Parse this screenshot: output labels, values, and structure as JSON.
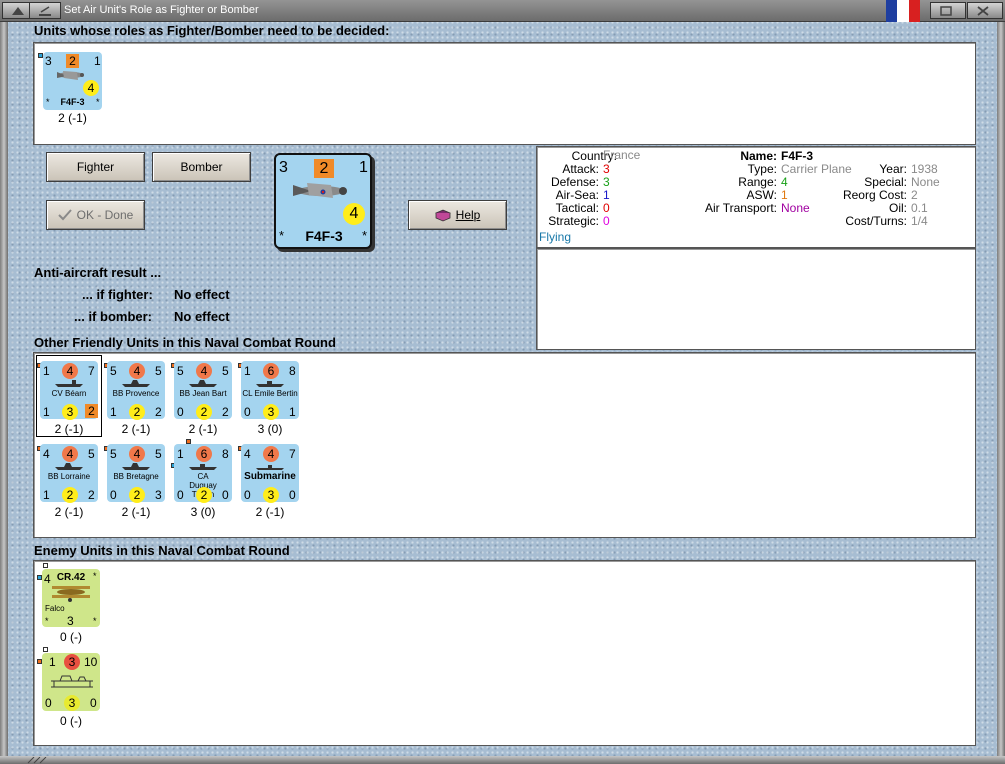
{
  "window": {
    "title": "Set Air Unit's Role as Fighter or Bomber"
  },
  "colors": {
    "flag": [
      "#1e3ea0",
      "#ffffff",
      "#d82020"
    ]
  },
  "sections": {
    "undecided": "Units whose roles as Fighter/Bomber need to be decided:",
    "friendly": "Other Friendly Units in this Naval Combat Round",
    "enemy": "Enemy Units in this Naval Combat Round"
  },
  "undecided_unit": {
    "tl": "3",
    "tc": "2",
    "tr": "1",
    "circle": "4",
    "name": "F4F-3",
    "star": "*",
    "caption": "2 (-1)"
  },
  "selected_unit": {
    "tl": "3",
    "tc": "2",
    "tr": "1",
    "circle": "4",
    "name": "F4F-3",
    "star": "*"
  },
  "buttons": {
    "fighter": "Fighter",
    "bomber": "Bomber",
    "ok": "OK - Done",
    "help": "Help"
  },
  "anti_aircraft": {
    "title": "Anti-aircraft result ...",
    "fighter_label": "... if fighter:",
    "fighter_value": "No effect",
    "bomber_label": "... if bomber:",
    "bomber_value": "No effect"
  },
  "info": {
    "country_label": "Country:",
    "country": "France",
    "attack_label": "Attack:",
    "attack": "3",
    "defense_label": "Defense:",
    "defense": "3",
    "airsea_label": "Air-Sea:",
    "airsea": "1",
    "tactical_label": "Tactical:",
    "tactical": "0",
    "strategic_label": "Strategic:",
    "strategic": "0",
    "status": "Flying",
    "name_label": "Name:",
    "name": "F4F-3",
    "type_label": "Type:",
    "type": "Carrier Plane",
    "range_label": "Range:",
    "range": "4",
    "asw_label": "ASW:",
    "asw": "1",
    "airtransport_label": "Air Transport:",
    "airtransport": "None",
    "year_label": "Year:",
    "year": "1938",
    "special_label": "Special:",
    "special": "None",
    "reorg_label": "Reorg Cost:",
    "reorg": "2",
    "oil_label": "Oil:",
    "oil": "0.1",
    "costturns_label": "Cost/Turns:",
    "costturns": "1/4"
  },
  "friendly_units": [
    {
      "tl": "1",
      "tc": "4",
      "tr": "7",
      "name": "CV Béarn",
      "bl": "1",
      "bc": "3",
      "br": "2",
      "br_square": true,
      "caption": "2 (-1)"
    },
    {
      "tl": "5",
      "tc": "4",
      "tr": "5",
      "name": "BB Provence",
      "bl": "1",
      "bc": "2",
      "br": "2",
      "caption": "2 (-1)"
    },
    {
      "tl": "5",
      "tc": "4",
      "tr": "5",
      "name": "BB Jean Bart",
      "bl": "0",
      "bc": "2",
      "br": "2",
      "caption": "2 (-1)"
    },
    {
      "tl": "1",
      "tc": "6",
      "tr": "8",
      "name": "CL Emile Bertin",
      "bl": "0",
      "bc": "3",
      "br": "1",
      "caption": "3 (0)"
    },
    {
      "tl": "4",
      "tc": "4",
      "tr": "5",
      "name": "BB Lorraine",
      "bl": "1",
      "bc": "2",
      "br": "2",
      "caption": "2 (-1)"
    },
    {
      "tl": "5",
      "tc": "4",
      "tr": "5",
      "name": "BB Bretagne",
      "bl": "0",
      "bc": "2",
      "br": "3",
      "caption": "2 (-1)"
    },
    {
      "tl": "1",
      "tc": "6",
      "tr": "8",
      "name": "CA Duguay Trouin",
      "bl": "0",
      "bc": "2",
      "br": "0",
      "caption": "3 (0)"
    },
    {
      "tl": "4",
      "tc": "4",
      "tr": "7",
      "name": "Submarine",
      "bl": "0",
      "bc": "3",
      "br": "0",
      "caption": "2 (-1)"
    }
  ],
  "enemy_units": [
    {
      "tl": "4",
      "top": "CR.42",
      "star": "*",
      "name": "Falco",
      "circle": "3",
      "caption": "0 (-)"
    },
    {
      "tl": "1",
      "tc": "3",
      "tr": "10",
      "bl": "0",
      "bc": "3",
      "br": "0",
      "caption": "0 (-)"
    }
  ]
}
